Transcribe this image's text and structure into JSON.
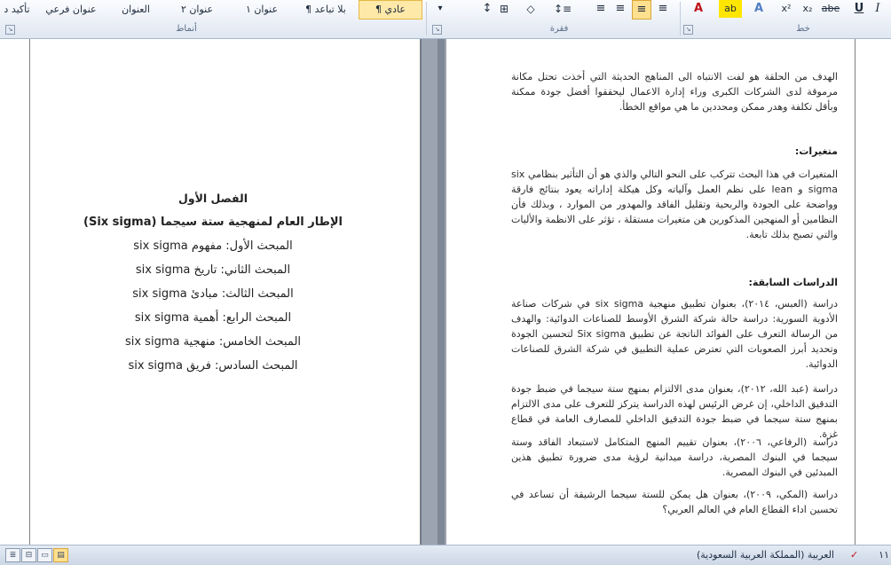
{
  "ribbon": {
    "styles": [
      "تأكيد د",
      "عنوان فرعي",
      "العنوان",
      "عنوان ٢",
      "عنوان ١",
      "¶ بلا تباعد",
      "¶ عادي"
    ],
    "groups": {
      "styles_label": "أنماط",
      "paragraph_label": "فقرة",
      "font_label": "خط"
    },
    "font_buttons": {
      "underline": "U",
      "italic": "I",
      "strike": "abe",
      "subscript": "x₂",
      "superscript": "x²",
      "effects": "A",
      "highlight": "ab",
      "fontcolor": "A"
    }
  },
  "left_page": {
    "chapter": "الفصل الأول",
    "title": "الإطار العام لمنهجية ستة سيجما (Six sigma)",
    "toc": [
      "المبحث الأول: مفهوم six sigma",
      "المبحث الثاني: تاريخ six sigma",
      "المبحث الثالث: مبادئ six sigma",
      "المبحث الرابع: أهمية six sigma",
      "المبحث الخامس: منهجية six sigma",
      "المبحث السادس: فريق six sigma"
    ]
  },
  "right_page": {
    "intro": "الهدف من الحلقة هو لفت الانتباه الى المناهج الحديثة التي أخذت تحتل مكانة مرموقة لدى الشركات الكبرى وراء إدارة الاعمال ليحققوا أفضل جودة ممكنة وبأقل تكلفة وهدر ممكن ومحددين ما هي مواقع الخطأ.",
    "variables_title": "متغيرات:",
    "variables_text": "المتغيرات في هذا البحث تتركب على النحو التالي والذي هو أن التأثير بنظامي six sigma و lean على نظم العمل وآلياته وكل هيكلة إداراته يعود بنتائج فارقة وواضحة على الجودة والربحية وتقليل الفاقد والمهدور من الموارد ، وبذلك فأن النظامين أو المنهجين المذكورين هن متغيرات مستقلة ، تؤثر على الانظمة والأليات والتي تصبح بذلك تابعة.",
    "studies_title": "الدراسات السابقة:",
    "studies": [
      "دراسة (العبس، ٢٠١٤)، بعنوان تطبيق منهجية six sigma في شركات صناعة الأدوية السورية: دراسة حالة شركة الشرق الأوسط للصناعات الدوائية: والهدف من الرسالة التعرف على الفوائد الناتجة عن تطبيق Six sigma لتحسين الجودة وتحديد أبرز الصعوبات التي تعترض عملية التطبيق في شركة الشرق للصناعات الدوائية.",
      "دراسة (عبد الله، ٢٠١٢)، بعنوان مدى الالتزام بمنهج ستة سيجما في ضبط جودة التدقيق الداخلي، إن غرض الرئيس لهذه الدراسة يتركز للتعرف على مدى الالتزام بمنهج ستة سيجما في ضبط جودة التدقيق الداخلي للمصارف العامة في قطاع غزة.",
      "دراسة (الرفاعي، ٢٠٠٦)، بعنوان تقييم المنهج المتكامل لاستبعاد الفاقد وستة سيجما في البنوك المصرية، دراسة ميدانية لرؤية مدى ضرورة تطبيق هذين المبدئين في البنوك المصرية.",
      "دراسة (المكي، ٢٠٠٩)، بعنوان هل يمكن للستة سيجما الرشيقة أن تساعد في تحسين اداء القطاع العام في العالم العربي؟"
    ]
  },
  "status": {
    "language": "العربية (المملكة العربية السعودية)",
    "page": "١١"
  }
}
